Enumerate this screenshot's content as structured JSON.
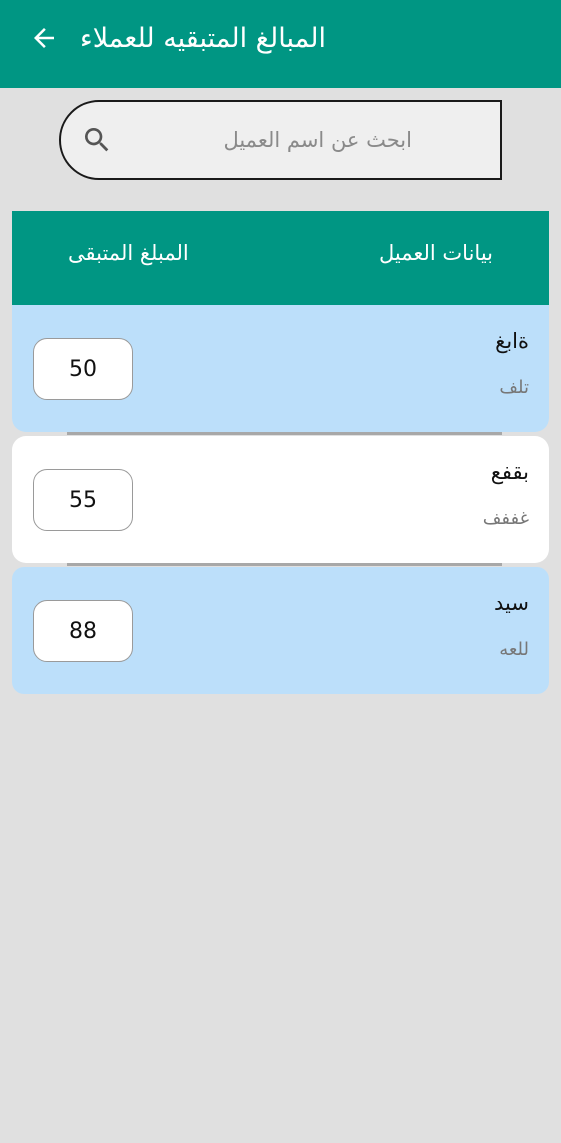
{
  "app_bar": {
    "title": "المبالغ المتبقيه للعملاء",
    "back_icon": "arrow-left-icon",
    "color": "#009683"
  },
  "search": {
    "placeholder": "ابحث عن اسم العميل",
    "value": "",
    "icon": "search-icon"
  },
  "table": {
    "header": {
      "client_label": "بيانات العميل",
      "amount_label": "المبلغ المتبقى"
    },
    "rows": [
      {
        "name": "ةابغ",
        "note": "تلف",
        "amount": "50"
      },
      {
        "name": "بقفع",
        "note": "غففف",
        "amount": "55"
      },
      {
        "name": "سيد",
        "note": "للعه",
        "amount": "88"
      }
    ]
  },
  "colors": {
    "accent": "#009683",
    "row_alt": "#bcdffa",
    "row_white": "#ffffff",
    "background": "#e0e0e0"
  }
}
